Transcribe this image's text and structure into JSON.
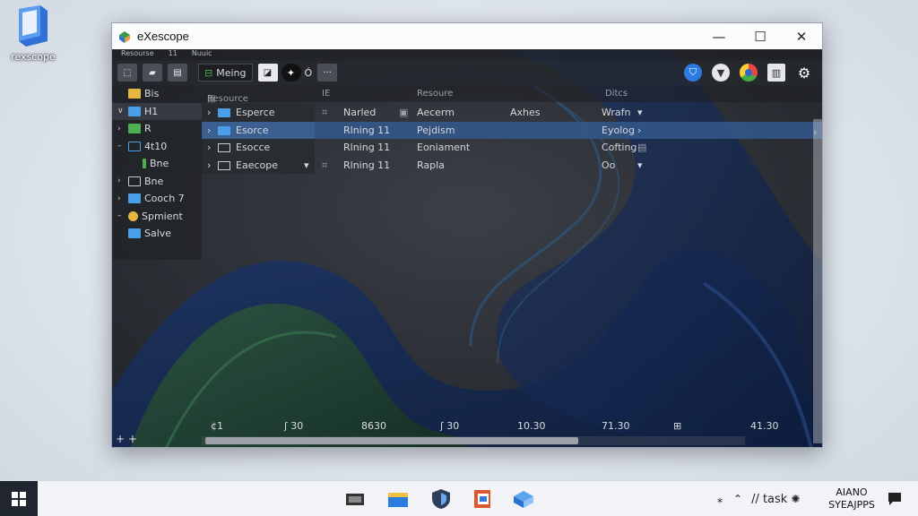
{
  "desktop": {
    "icon_label": "rexscope"
  },
  "window": {
    "title": "eXescope",
    "controls": {
      "minimize": "—",
      "maximize": "☐",
      "close": "✕"
    },
    "menu": [
      "Resourse",
      "11",
      "Nuuic"
    ],
    "toolbar": {
      "field_text": "Meing",
      "text_label": "Ó",
      "more": "···"
    },
    "tree": [
      {
        "label": "Bis",
        "twisty": "",
        "color": "#e6b740",
        "selected": false
      },
      {
        "label": "H1",
        "twisty": "∨",
        "color": "#4aa0e8",
        "selected": true
      },
      {
        "label": "R",
        "twisty": "›",
        "color": "#4caf50",
        "selected": false
      },
      {
        "label": "4t10",
        "twisty": "–",
        "color": "#4aa0e8",
        "selected": false
      },
      {
        "label": "Bne",
        "twisty": "",
        "color": "#4caf50",
        "selected": false
      },
      {
        "label": "Bne",
        "twisty": "›",
        "color": "#9aa0a8",
        "selected": false
      },
      {
        "label": "Cooch 7",
        "twisty": "›",
        "color": "#4aa0e8",
        "selected": false
      },
      {
        "label": "Spmient",
        "twisty": "–",
        "color": "#e6b740",
        "selected": false
      },
      {
        "label": "Salve",
        "twisty": "",
        "color": "#4aa0e8",
        "selected": false
      }
    ],
    "columns": [
      "Resource",
      "IE",
      "Resoure",
      "Ditcs"
    ],
    "rows": [
      {
        "name": "Esperce",
        "c1": "Narled",
        "c2": "Aecerm",
        "c3": "Axhes",
        "c4": "Wrafn",
        "selected": false
      },
      {
        "name": "Esorce",
        "c1": "Rlning 11",
        "c2": "Pejdism",
        "c3": "",
        "c4": "Eyolog",
        "selected": true
      },
      {
        "name": "Esocce",
        "c1": "Rlning 11",
        "c2": "Eoniament",
        "c3": "",
        "c4": "Cofting",
        "selected": false
      },
      {
        "name": "Eaecope",
        "c1": "Rlning 11",
        "c2": "Rapla",
        "c3": "",
        "c4": "Oo",
        "selected": false
      }
    ],
    "status": [
      "¢1",
      "ʃ 30",
      "8630",
      "ʃ 30",
      "10.30",
      "71.30",
      "41.30"
    ],
    "bottom_left": "+ +"
  },
  "taskbar": {
    "tray_text": "// task",
    "clock_line1": "AIANO",
    "clock_line2": "SYEAJPPS"
  },
  "colors": {
    "accent": "#3a64a0",
    "window_bg": "#2c2f35"
  }
}
